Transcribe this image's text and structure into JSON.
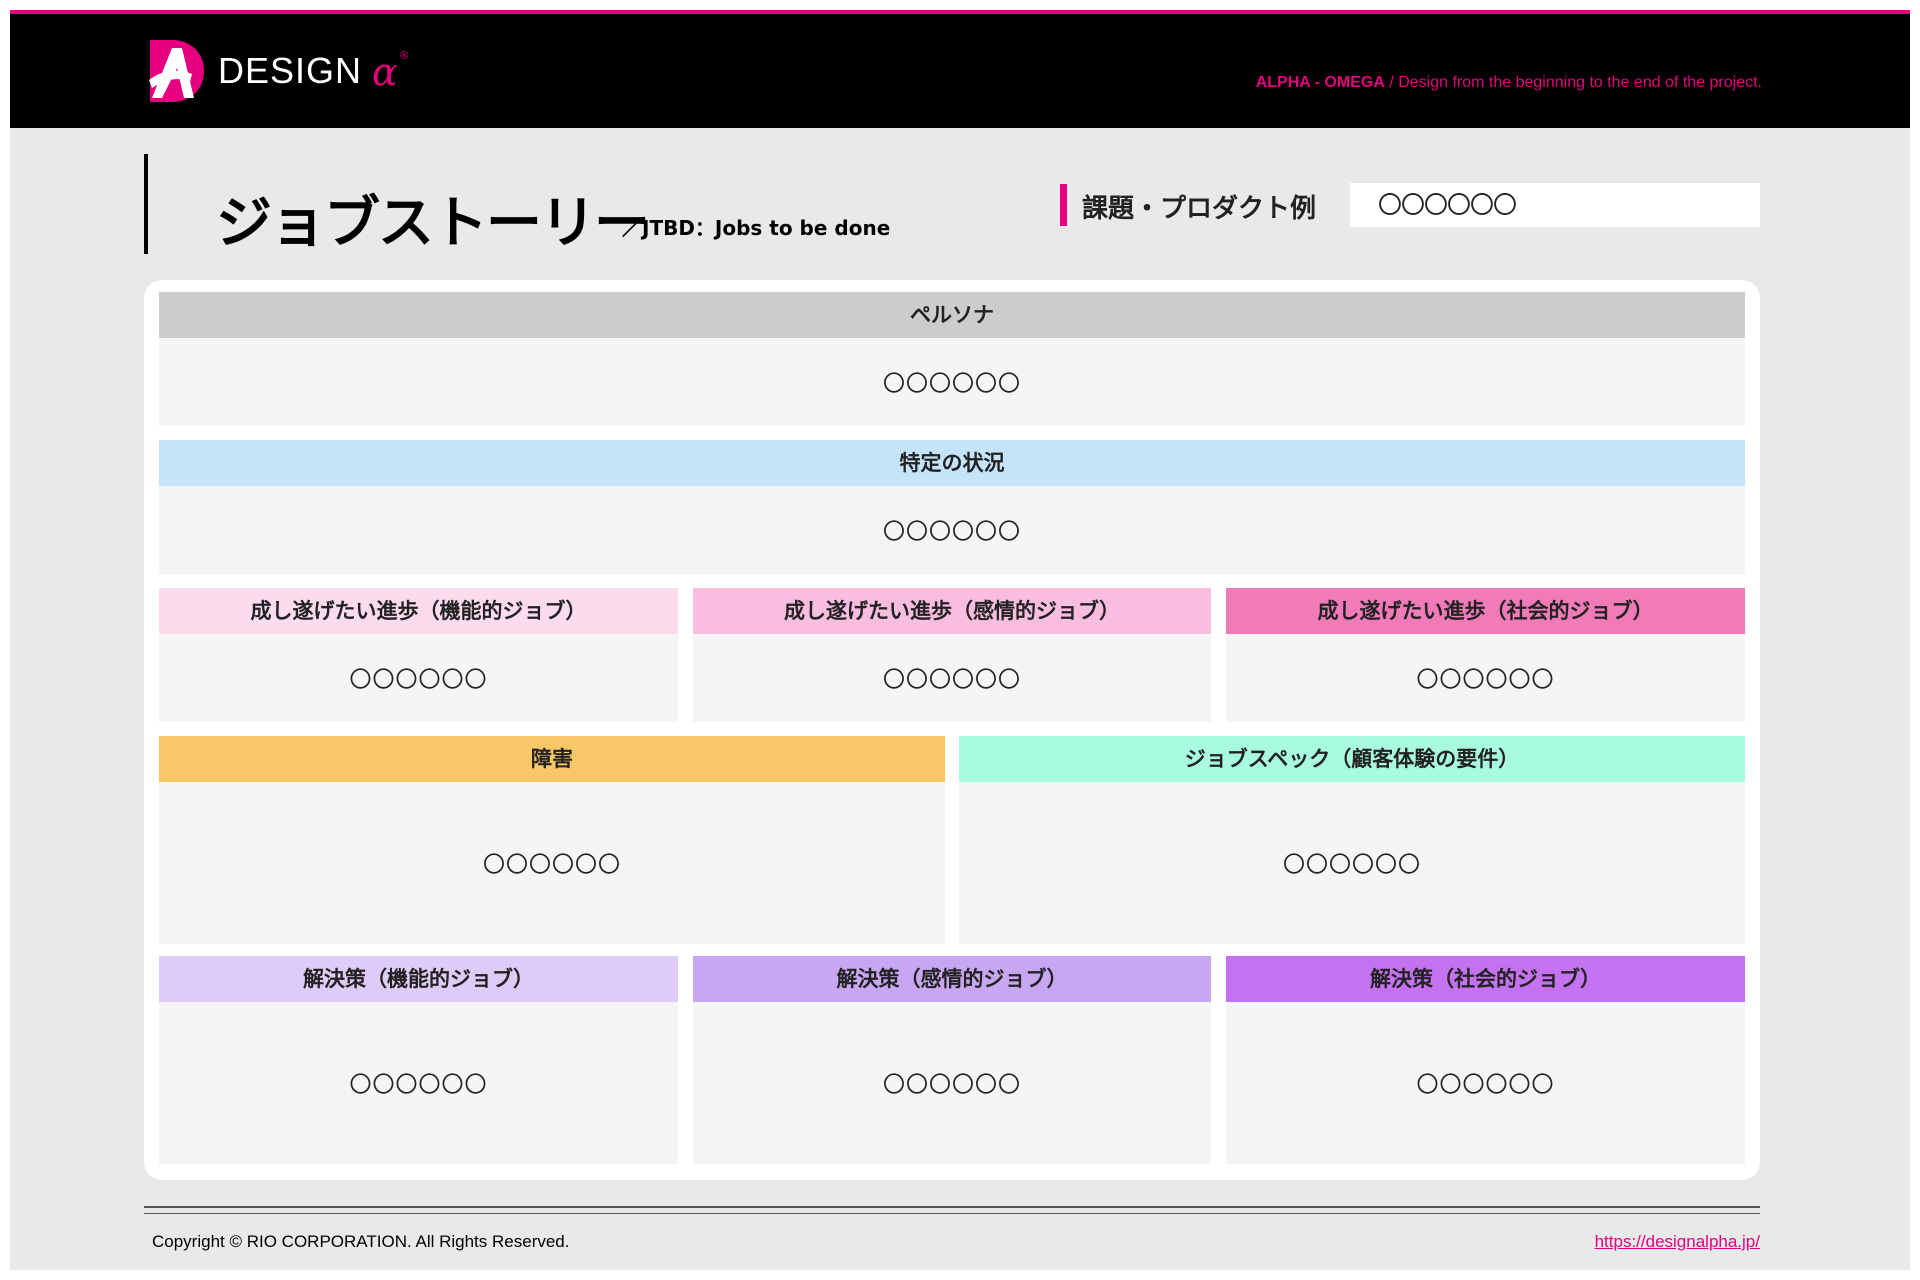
{
  "header": {
    "logo_text": "DESIGN",
    "logo_symbol": "α",
    "tagline_brand": "ALPHA - OMEGA",
    "tagline_rest": " / Design from the beginning to the end of the project.",
    "accent_color": "#e4007f"
  },
  "title": {
    "main": "ジョブストーリー",
    "sub": "／JTBD：Jobs to be done",
    "example_label": "課題・プロダクト例",
    "example_value": "〇〇〇〇〇〇"
  },
  "sections": {
    "persona": {
      "label": "ペルソナ",
      "value": "〇〇〇〇〇〇",
      "color": "#cccccc"
    },
    "situation": {
      "label": "特定の状況",
      "value": "〇〇〇〇〇〇",
      "color": "#c5e4fa"
    },
    "progress_functional": {
      "label": "成し遂げたい進歩（機能的ジョブ）",
      "value": "〇〇〇〇〇〇",
      "color": "#fcdcec"
    },
    "progress_emotional": {
      "label": "成し遂げたい進歩（感情的ジョブ）",
      "value": "〇〇〇〇〇〇",
      "color": "#f9bde0"
    },
    "progress_social": {
      "label": "成し遂げたい進歩（社会的ジョブ）",
      "value": "〇〇〇〇〇〇",
      "color": "#f17ab9"
    },
    "obstacle": {
      "label": "障害",
      "value": "〇〇〇〇〇〇",
      "color": "#f8c868"
    },
    "job_spec": {
      "label": "ジョブスペック（顧客体験の要件）",
      "value": "〇〇〇〇〇〇",
      "color": "#a8fbe0"
    },
    "solution_functional": {
      "label": "解決策（機能的ジョブ）",
      "value": "〇〇〇〇〇〇",
      "color": "#dfcbf7"
    },
    "solution_emotional": {
      "label": "解決策（感情的ジョブ）",
      "value": "〇〇〇〇〇〇",
      "color": "#c9a6f2"
    },
    "solution_social": {
      "label": "解決策（社会的ジョブ）",
      "value": "〇〇〇〇〇〇",
      "color": "#c472ef"
    }
  },
  "footer": {
    "copyright": "Copyright © RIO CORPORATION. All Rights Reserved.",
    "link": "https://designalpha.jp/"
  }
}
